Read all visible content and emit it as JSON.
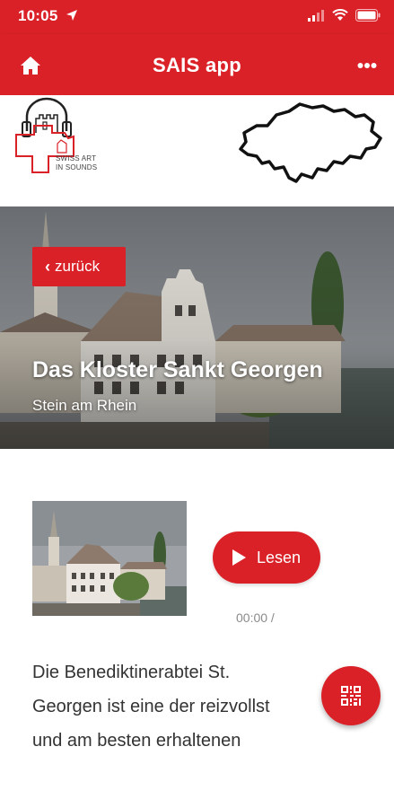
{
  "status_bar": {
    "time": "10:05",
    "icons": [
      "location-arrow-icon",
      "signal-icon",
      "wifi-icon",
      "battery-icon"
    ]
  },
  "app_bar": {
    "title": "SAIS app",
    "left_icon": "home-icon",
    "right_icon": "more-dots-icon"
  },
  "logo": {
    "line1": "SWISS ART",
    "line2": "IN SOUNDS"
  },
  "hero": {
    "back_label": "zurück",
    "title": "Das Kloster Sankt Georgen",
    "subtitle": "Stein am Rhein"
  },
  "player": {
    "button_label": "Lesen",
    "time": "00:00 /"
  },
  "description": {
    "lines": [
      "Die Benediktinerabtei St.",
      "Georgen ist eine der reizvollst",
      "und am besten erhaltenen"
    ]
  },
  "fab": {
    "icon": "qr-code-icon"
  },
  "colors": {
    "accent": "#da2128",
    "text": "#333333",
    "muted": "#8a8a8a"
  }
}
